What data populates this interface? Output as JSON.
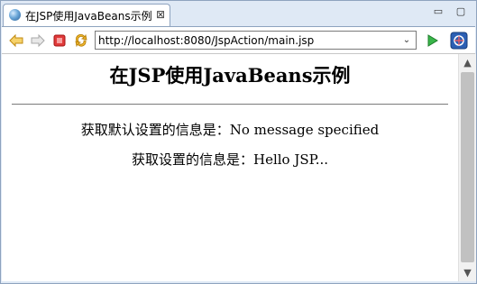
{
  "tab": {
    "title": "在JSP使用JavaBeans示例",
    "close_glyph": "⊠"
  },
  "window_controls": {
    "minimize_glyph": "▭",
    "maximize_glyph": "▢"
  },
  "toolbar": {
    "url": "http://localhost:8080/JspAction/main.jsp",
    "dropdown_glyph": "⌄",
    "icons": [
      "back-arrow-icon",
      "forward-arrow-icon",
      "stop-icon",
      "refresh-icon",
      "go-icon",
      "external-browser-icon"
    ]
  },
  "page": {
    "heading": "在JSP使用JavaBeans示例",
    "default_line": "获取默认设置的信息是：No message specified",
    "set_line": "获取设置的信息是：Hello JSP..."
  },
  "scrollbar": {
    "up_glyph": "▲",
    "down_glyph": "▼"
  },
  "colors": {
    "chrome_bg": "#dfe9f5",
    "border": "#8ea3bf",
    "back_fwd": "#f0c040",
    "stop": "#d83030",
    "go": "#2fa83a"
  }
}
